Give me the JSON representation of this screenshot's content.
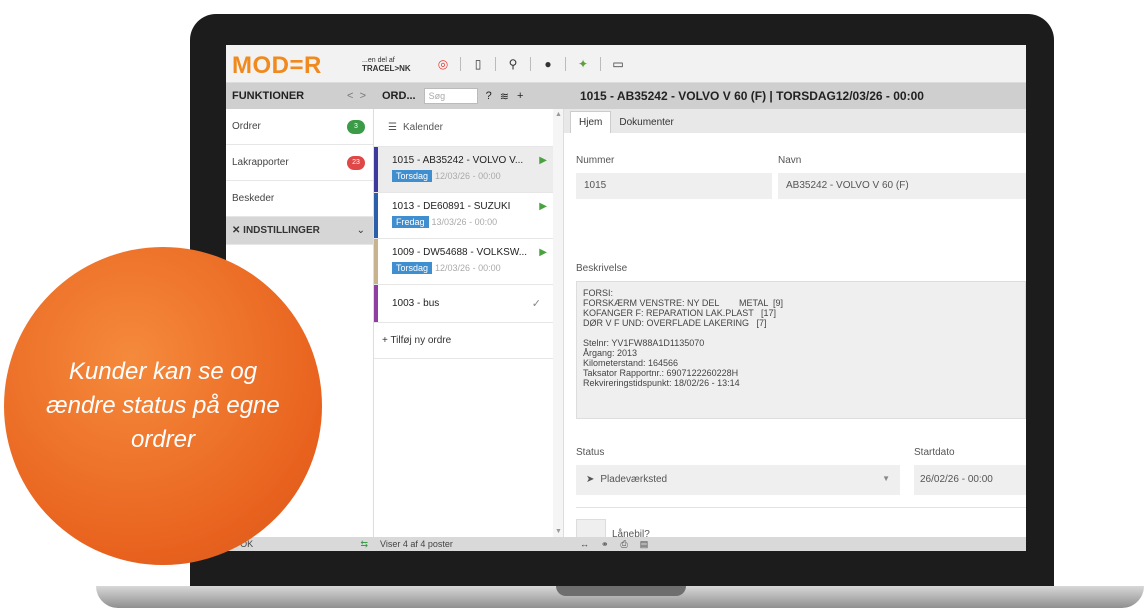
{
  "header": {
    "logo": "MOD=R",
    "logo_sub_top": "...en del af",
    "logo_sub_bottom": "TRACEL>NK",
    "functions_label": "FUNKTIONER",
    "orders_label": "ORD...",
    "search_placeholder": "Søg",
    "detail_title": "1015 - AB35242 - VOLVO V 60 (F) | TORSDAG12/03/26 - 00:00"
  },
  "sidebar": {
    "items": [
      {
        "label": "Ordrer",
        "badge": "3",
        "badge_color": "#3b9b46"
      },
      {
        "label": "Lakrapporter",
        "badge": "23",
        "badge_color": "#e04848"
      },
      {
        "label": "Beskeder"
      },
      {
        "label": "INDSTILLINGER"
      }
    ]
  },
  "orders": {
    "calendar_label": "Kalender",
    "list": [
      {
        "title": "1015 - AB35242 - VOLVO V...",
        "day": "Torsdag",
        "date": "12/03/26 - 00:00",
        "color": "#3d3a9c"
      },
      {
        "title": "1013 - DE60891 - SUZUKI",
        "day": "Fredag",
        "date": "13/03/26 - 00:00",
        "color": "#2b5faa"
      },
      {
        "title": "1009 - DW54688 - VOLKSW...",
        "day": "Torsdag",
        "date": "12/03/26 - 00:00",
        "color": "#c8b38f"
      },
      {
        "title": "1003 - bus",
        "color": "#8e3fa0"
      }
    ],
    "add_label": "+ Tilføj ny ordre"
  },
  "detail": {
    "tabs": [
      "Hjem",
      "Dokumenter"
    ],
    "number_label": "Nummer",
    "number_value": "1015",
    "name_label": "Navn",
    "name_value": "AB35242 - VOLVO V 60 (F)",
    "description_label": "Beskrivelse",
    "description_value": "FORSI:\nFORSKÆRM VENSTRE: NY DEL        METAL  [9]\nKOFANGER F: REPARATION LAK.PLAST   [17]\nDØR V F UND: OVERFLADE LAKERING   [7]\n\nStelnr: YV1FW88A1D1135070\nÅrgang: 2013\nKilometerstand: 164566\nTaksator Rapportnr.: 6907122260228H\nRekvireringstidspunkt: 18/02/26 - 13:14",
    "status_label": "Status",
    "status_value": "Pladeværksted",
    "start_label": "Startdato",
    "start_value": "26/02/26 - 00:00",
    "loan_label": "Lånebil?"
  },
  "statusbar": {
    "ok": "OK",
    "count": "Viser 4 af 4 poster"
  },
  "promo": {
    "text": "Kunder kan se og ændre status på egne ordrer",
    "color": "#e8621e"
  }
}
